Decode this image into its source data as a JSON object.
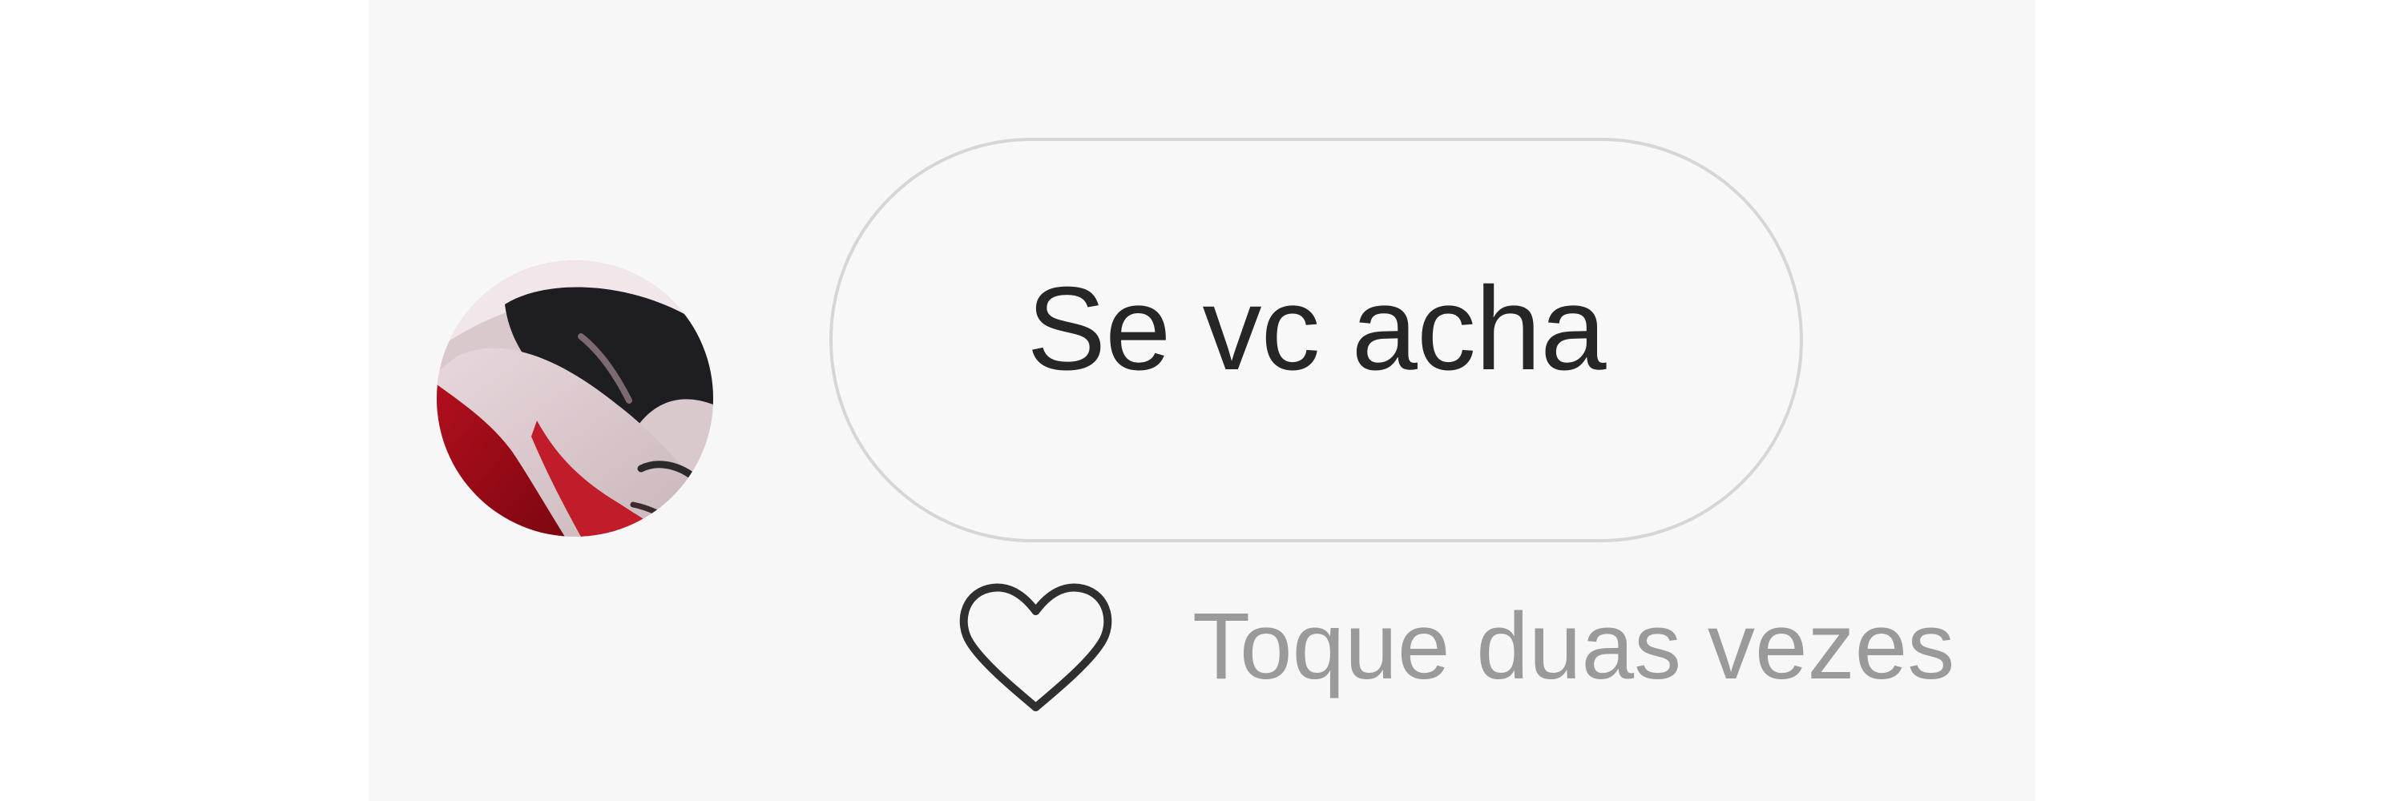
{
  "conversation": {
    "avatar": {
      "icon": "profile-photo-avatar"
    },
    "message": {
      "text": "Se vc acha"
    },
    "reaction": {
      "icon": "heart-outline-icon",
      "hint": "Toque duas vezes"
    }
  },
  "colors": {
    "page_background": "#ffffff",
    "chat_background": "#f7f7f7",
    "bubble_border": "#d6d6d6",
    "message_text": "#262626",
    "hint_text": "#9a9a9a",
    "heart_stroke": "#2f2f2f"
  }
}
